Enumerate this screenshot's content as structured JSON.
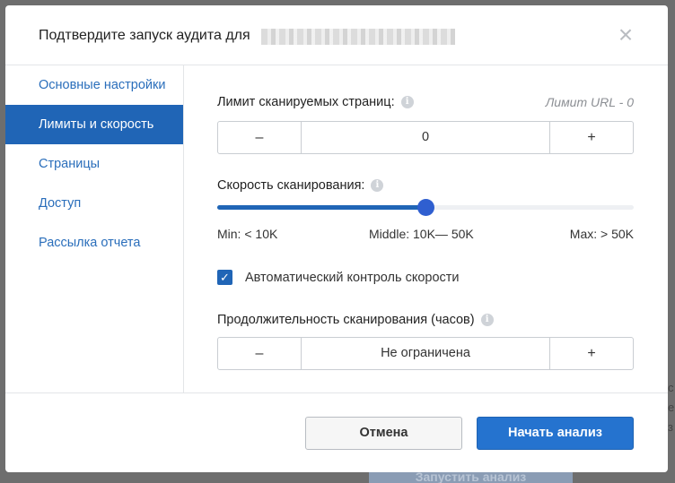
{
  "background": {
    "button_label": "Запустить анализ",
    "letters": [
      "с",
      "е",
      "з"
    ]
  },
  "modal": {
    "title": "Подтвердите запуск аудита для",
    "close_icon": "close-icon"
  },
  "sidebar": {
    "items": [
      {
        "label": "Основные настройки",
        "active": false
      },
      {
        "label": "Лимиты и скорость",
        "active": true
      },
      {
        "label": "Страницы",
        "active": false
      },
      {
        "label": "Доступ",
        "active": false
      },
      {
        "label": "Рассылка отчета",
        "active": false
      }
    ]
  },
  "page_limit": {
    "label": "Лимит сканируемых страниц:",
    "note": "Лимит URL - 0",
    "minus": "–",
    "value": "0",
    "plus": "+"
  },
  "scan_speed": {
    "label": "Скорость сканирования:",
    "level": 0.5,
    "min_label": "Min: < 10K",
    "middle_label": "Middle: 10K— 50K",
    "max_label": "Max: > 50K"
  },
  "auto_speed": {
    "checked": true,
    "label": "Автоматический контроль скорости"
  },
  "duration": {
    "label": "Продолжительность сканирования (часов)",
    "minus": "–",
    "value": "Не ограничена",
    "plus": "+"
  },
  "footer": {
    "cancel_label": "Отмена",
    "start_label": "Начать анализ"
  },
  "colors": {
    "accent": "#2065b6",
    "primary_button": "#2573cf",
    "link": "#2a6ebb"
  }
}
